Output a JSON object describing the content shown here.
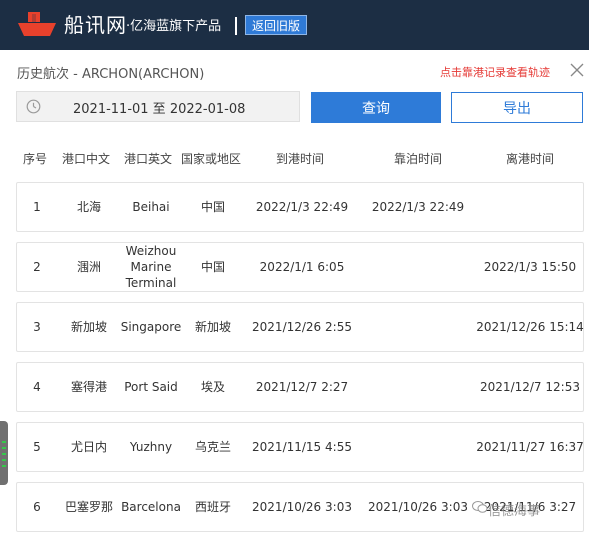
{
  "header": {
    "brand": "船讯网",
    "subtitle": "·亿海蓝旗下产品",
    "back_label": "返回旧版"
  },
  "voyage": {
    "title": "历史航次 - ARCHON(ARCHON)",
    "berth_link": "点击靠港记录查看轨迹"
  },
  "controls": {
    "date_range": "2021-11-01 至 2022-01-08",
    "query_label": "查询",
    "export_label": "导出"
  },
  "table": {
    "headers": [
      "序号",
      "港口中文",
      "港口英文",
      "国家或地区",
      "到港时间",
      "靠泊时间",
      "离港时间"
    ],
    "rows": [
      {
        "no": "1",
        "port_cn": "北海",
        "port_en": "Beihai",
        "country": "中国",
        "arrival": "2022/1/3 22:49",
        "berth": "2022/1/3 22:49",
        "departure": ""
      },
      {
        "no": "2",
        "port_cn": "涠洲",
        "port_en": "Weizhou Marine Terminal",
        "country": "中国",
        "arrival": "2022/1/1 6:05",
        "berth": "",
        "departure": "2022/1/3 15:50"
      },
      {
        "no": "3",
        "port_cn": "新加坡",
        "port_en": "Singapore",
        "country": "新加坡",
        "arrival": "2021/12/26 2:55",
        "berth": "",
        "departure": "2021/12/26 15:14"
      },
      {
        "no": "4",
        "port_cn": "塞得港",
        "port_en": "Port Said",
        "country": "埃及",
        "arrival": "2021/12/7 2:27",
        "berth": "",
        "departure": "2021/12/7 12:53"
      },
      {
        "no": "5",
        "port_cn": "尤日内",
        "port_en": "Yuzhny",
        "country": "乌克兰",
        "arrival": "2021/11/15 4:55",
        "berth": "",
        "departure": "2021/11/27 16:37"
      },
      {
        "no": "6",
        "port_cn": "巴塞罗那",
        "port_en": "Barcelona",
        "country": "西班牙",
        "arrival": "2021/10/26 3:03",
        "berth": "2021/10/26 3:03",
        "departure": "2021/11/6 3:27"
      }
    ]
  },
  "watermark": "信德海事",
  "colors": {
    "header_bg": "#1c2e44",
    "accent": "#2e7bd8",
    "link_red": "#e53935"
  }
}
